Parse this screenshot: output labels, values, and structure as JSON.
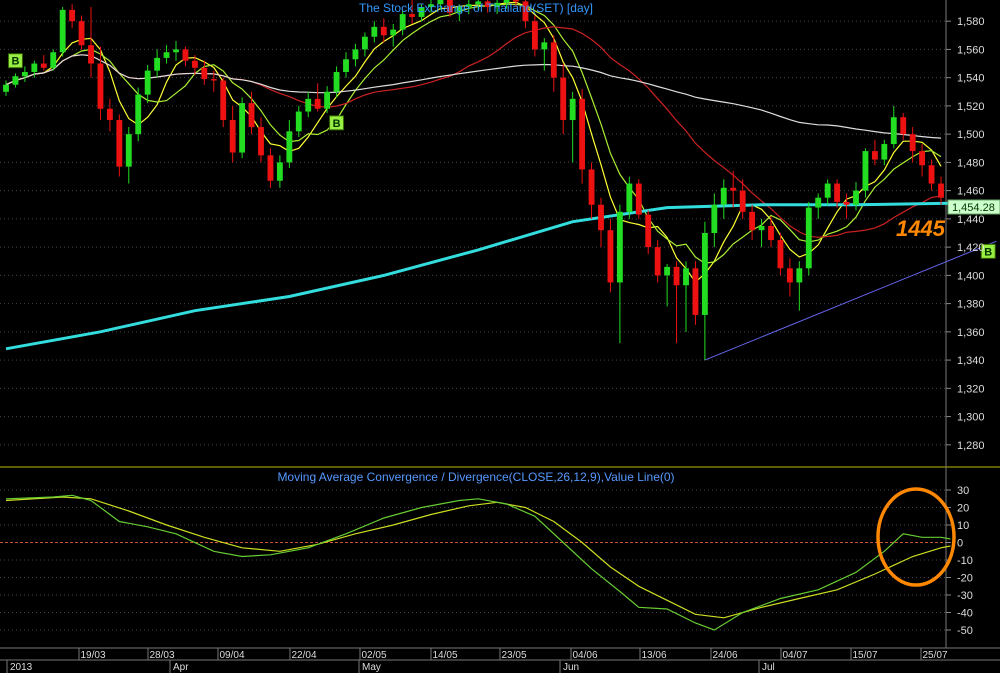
{
  "chart_data": {
    "type": "candlestick",
    "title": "The Stock Exchange of Thailand(SET) [day]",
    "last_price_label": "1,454.28",
    "annotation_text": "1445",
    "y_ticks": [
      "1,580",
      "1,560",
      "1,540",
      "1,520",
      "1,500",
      "1,480",
      "1,460",
      "1,440",
      "1,420",
      "1,400",
      "1,380",
      "1,360",
      "1,340",
      "1,320",
      "1,300",
      "1,280"
    ],
    "ylim": [
      1265,
      1595
    ],
    "x_date_labels": [
      "19/03",
      "28/03",
      "09/04",
      "22/04",
      "02/05",
      "14/05",
      "23/05",
      "04/06",
      "13/06",
      "24/06",
      "04/07",
      "15/07",
      "25/07"
    ],
    "x_month_labels": [
      "2013",
      "Apr",
      "May",
      "Jun",
      "Jul"
    ],
    "buy_marker_text": "B",
    "buy_markers": [
      {
        "i": 1,
        "price": 1552
      },
      {
        "i": 35,
        "price": 1508
      },
      {
        "i": 104,
        "price": 1417
      }
    ],
    "candles": [
      [
        1530,
        1538,
        1527,
        1535
      ],
      [
        1535,
        1543,
        1533,
        1541
      ],
      [
        1541,
        1548,
        1537,
        1544
      ],
      [
        1544,
        1552,
        1540,
        1550
      ],
      [
        1550,
        1556,
        1545,
        1547
      ],
      [
        1547,
        1560,
        1545,
        1558
      ],
      [
        1558,
        1590,
        1555,
        1588
      ],
      [
        1588,
        1592,
        1575,
        1580
      ],
      [
        1580,
        1584,
        1560,
        1563
      ],
      [
        1563,
        1590,
        1540,
        1550
      ],
      [
        1550,
        1562,
        1510,
        1518
      ],
      [
        1518,
        1525,
        1502,
        1510
      ],
      [
        1510,
        1514,
        1470,
        1477
      ],
      [
        1477,
        1505,
        1465,
        1500
      ],
      [
        1500,
        1533,
        1495,
        1528
      ],
      [
        1528,
        1549,
        1522,
        1545
      ],
      [
        1545,
        1560,
        1540,
        1554
      ],
      [
        1554,
        1563,
        1550,
        1558
      ],
      [
        1558,
        1566,
        1552,
        1560
      ],
      [
        1560,
        1562,
        1548,
        1552
      ],
      [
        1552,
        1556,
        1542,
        1547
      ],
      [
        1547,
        1552,
        1535,
        1539
      ],
      [
        1539,
        1545,
        1530,
        1538
      ],
      [
        1538,
        1540,
        1505,
        1510
      ],
      [
        1510,
        1520,
        1480,
        1487
      ],
      [
        1487,
        1526,
        1483,
        1522
      ],
      [
        1522,
        1530,
        1500,
        1505
      ],
      [
        1505,
        1512,
        1480,
        1485
      ],
      [
        1485,
        1490,
        1462,
        1467
      ],
      [
        1467,
        1485,
        1462,
        1480
      ],
      [
        1480,
        1510,
        1476,
        1502
      ],
      [
        1502,
        1520,
        1498,
        1516
      ],
      [
        1516,
        1530,
        1512,
        1525
      ],
      [
        1525,
        1536,
        1516,
        1518
      ],
      [
        1518,
        1534,
        1515,
        1530
      ],
      [
        1530,
        1548,
        1526,
        1544
      ],
      [
        1544,
        1558,
        1540,
        1553
      ],
      [
        1553,
        1564,
        1548,
        1560
      ],
      [
        1560,
        1572,
        1555,
        1569
      ],
      [
        1569,
        1580,
        1565,
        1576
      ],
      [
        1576,
        1582,
        1565,
        1570
      ],
      [
        1570,
        1578,
        1562,
        1574
      ],
      [
        1574,
        1588,
        1570,
        1585
      ],
      [
        1585,
        1596,
        1578,
        1583
      ],
      [
        1583,
        1592,
        1580,
        1590
      ],
      [
        1590,
        1596,
        1586,
        1592
      ],
      [
        1592,
        1598,
        1588,
        1595
      ],
      [
        1595,
        1597,
        1583,
        1586
      ],
      [
        1586,
        1592,
        1580,
        1590
      ],
      [
        1590,
        1597,
        1585,
        1592
      ],
      [
        1592,
        1598,
        1588,
        1594
      ],
      [
        1594,
        1598,
        1586,
        1590
      ],
      [
        1590,
        1596,
        1585,
        1593
      ],
      [
        1593,
        1598,
        1589,
        1596
      ],
      [
        1596,
        1600,
        1590,
        1594
      ],
      [
        1594,
        1598,
        1575,
        1580
      ],
      [
        1580,
        1584,
        1555,
        1560
      ],
      [
        1560,
        1568,
        1545,
        1565
      ],
      [
        1565,
        1570,
        1530,
        1540
      ],
      [
        1540,
        1550,
        1500,
        1510
      ],
      [
        1510,
        1530,
        1480,
        1525
      ],
      [
        1525,
        1532,
        1465,
        1475
      ],
      [
        1475,
        1480,
        1440,
        1450
      ],
      [
        1450,
        1455,
        1420,
        1432
      ],
      [
        1432,
        1440,
        1388,
        1395
      ],
      [
        1395,
        1450,
        1352,
        1445
      ],
      [
        1445,
        1470,
        1440,
        1465
      ],
      [
        1465,
        1468,
        1440,
        1443
      ],
      [
        1443,
        1446,
        1415,
        1420
      ],
      [
        1420,
        1425,
        1395,
        1400
      ],
      [
        1400,
        1408,
        1378,
        1406
      ],
      [
        1406,
        1410,
        1352,
        1393
      ],
      [
        1393,
        1410,
        1360,
        1405
      ],
      [
        1405,
        1410,
        1365,
        1372
      ],
      [
        1372,
        1438,
        1340,
        1430
      ],
      [
        1430,
        1458,
        1420,
        1450
      ],
      [
        1450,
        1468,
        1440,
        1462
      ],
      [
        1462,
        1474,
        1448,
        1460
      ],
      [
        1460,
        1468,
        1440,
        1445
      ],
      [
        1445,
        1450,
        1425,
        1432
      ],
      [
        1432,
        1440,
        1420,
        1435
      ],
      [
        1435,
        1442,
        1420,
        1425
      ],
      [
        1425,
        1430,
        1400,
        1405
      ],
      [
        1405,
        1412,
        1385,
        1395
      ],
      [
        1395,
        1410,
        1375,
        1405
      ],
      [
        1405,
        1452,
        1400,
        1448
      ],
      [
        1448,
        1458,
        1440,
        1455
      ],
      [
        1455,
        1468,
        1450,
        1465
      ],
      [
        1465,
        1468,
        1448,
        1452
      ],
      [
        1452,
        1458,
        1440,
        1450
      ],
      [
        1450,
        1466,
        1446,
        1460
      ],
      [
        1460,
        1490,
        1455,
        1488
      ],
      [
        1488,
        1496,
        1478,
        1482
      ],
      [
        1482,
        1496,
        1478,
        1493
      ],
      [
        1493,
        1520,
        1490,
        1512
      ],
      [
        1512,
        1515,
        1496,
        1500
      ],
      [
        1500,
        1505,
        1480,
        1488
      ],
      [
        1488,
        1493,
        1470,
        1478
      ],
      [
        1478,
        1482,
        1460,
        1465
      ],
      [
        1465,
        1470,
        1450,
        1455
      ]
    ],
    "moving_averages": [
      {
        "color": "#ffff33",
        "period": 5
      },
      {
        "color": "#aaee33",
        "period": 8
      },
      {
        "color": "#cc2222",
        "period": 25
      },
      {
        "color": "#dddddd",
        "period": 75
      },
      {
        "color": "#33dddd",
        "period": 200
      }
    ],
    "ma200": {
      "color": "#33dddd",
      "points": [
        [
          0,
          1348
        ],
        [
          10,
          1360
        ],
        [
          20,
          1375
        ],
        [
          30,
          1385
        ],
        [
          40,
          1400
        ],
        [
          50,
          1418
        ],
        [
          60,
          1438
        ],
        [
          70,
          1448
        ],
        [
          80,
          1450
        ],
        [
          90,
          1450
        ],
        [
          100,
          1451
        ],
        [
          104,
          1452
        ]
      ]
    },
    "trendline": {
      "color": "#6666ee",
      "points": [
        [
          74,
          1340
        ],
        [
          104,
          1422
        ]
      ]
    },
    "macd": {
      "title": "Moving Average Convergence / Divergence(CLOSE,26,12,9),Value Line(0)",
      "y_ticks": [
        30,
        20,
        10,
        0,
        -10,
        -20,
        -30,
        -40,
        -50
      ],
      "ylim": [
        -58,
        34
      ],
      "macd_color": "#66cc33",
      "signal_color": "#ccdd22",
      "zero_line_color": "#cc5533",
      "macd_line": [
        [
          0,
          25
        ],
        [
          5,
          26
        ],
        [
          7,
          27
        ],
        [
          9,
          24
        ],
        [
          12,
          12
        ],
        [
          15,
          9
        ],
        [
          18,
          5
        ],
        [
          22,
          -5
        ],
        [
          25,
          -8
        ],
        [
          28,
          -7
        ],
        [
          32,
          -3
        ],
        [
          36,
          5
        ],
        [
          40,
          14
        ],
        [
          44,
          20
        ],
        [
          48,
          24
        ],
        [
          50,
          25
        ],
        [
          53,
          22
        ],
        [
          56,
          15
        ],
        [
          59,
          0
        ],
        [
          62,
          -15
        ],
        [
          65,
          -28
        ],
        [
          67,
          -37
        ],
        [
          70,
          -38
        ],
        [
          73,
          -46
        ],
        [
          75,
          -50
        ],
        [
          78,
          -40
        ],
        [
          82,
          -32
        ],
        [
          86,
          -27
        ],
        [
          90,
          -17
        ],
        [
          93,
          -5
        ],
        [
          95,
          5
        ],
        [
          97,
          3
        ],
        [
          99,
          3
        ],
        [
          100,
          2
        ]
      ],
      "signal_line": [
        [
          0,
          24
        ],
        [
          6,
          26
        ],
        [
          9,
          25
        ],
        [
          13,
          18
        ],
        [
          17,
          10
        ],
        [
          21,
          3
        ],
        [
          25,
          -3
        ],
        [
          29,
          -5
        ],
        [
          33,
          -1
        ],
        [
          37,
          5
        ],
        [
          41,
          10
        ],
        [
          45,
          16
        ],
        [
          49,
          21
        ],
        [
          52,
          23
        ],
        [
          55,
          20
        ],
        [
          58,
          12
        ],
        [
          61,
          0
        ],
        [
          64,
          -14
        ],
        [
          67,
          -25
        ],
        [
          70,
          -33
        ],
        [
          73,
          -41
        ],
        [
          76,
          -43
        ],
        [
          80,
          -37
        ],
        [
          84,
          -32
        ],
        [
          88,
          -27
        ],
        [
          92,
          -18
        ],
        [
          96,
          -8
        ],
        [
          99,
          -3
        ],
        [
          100,
          -2
        ]
      ]
    }
  }
}
